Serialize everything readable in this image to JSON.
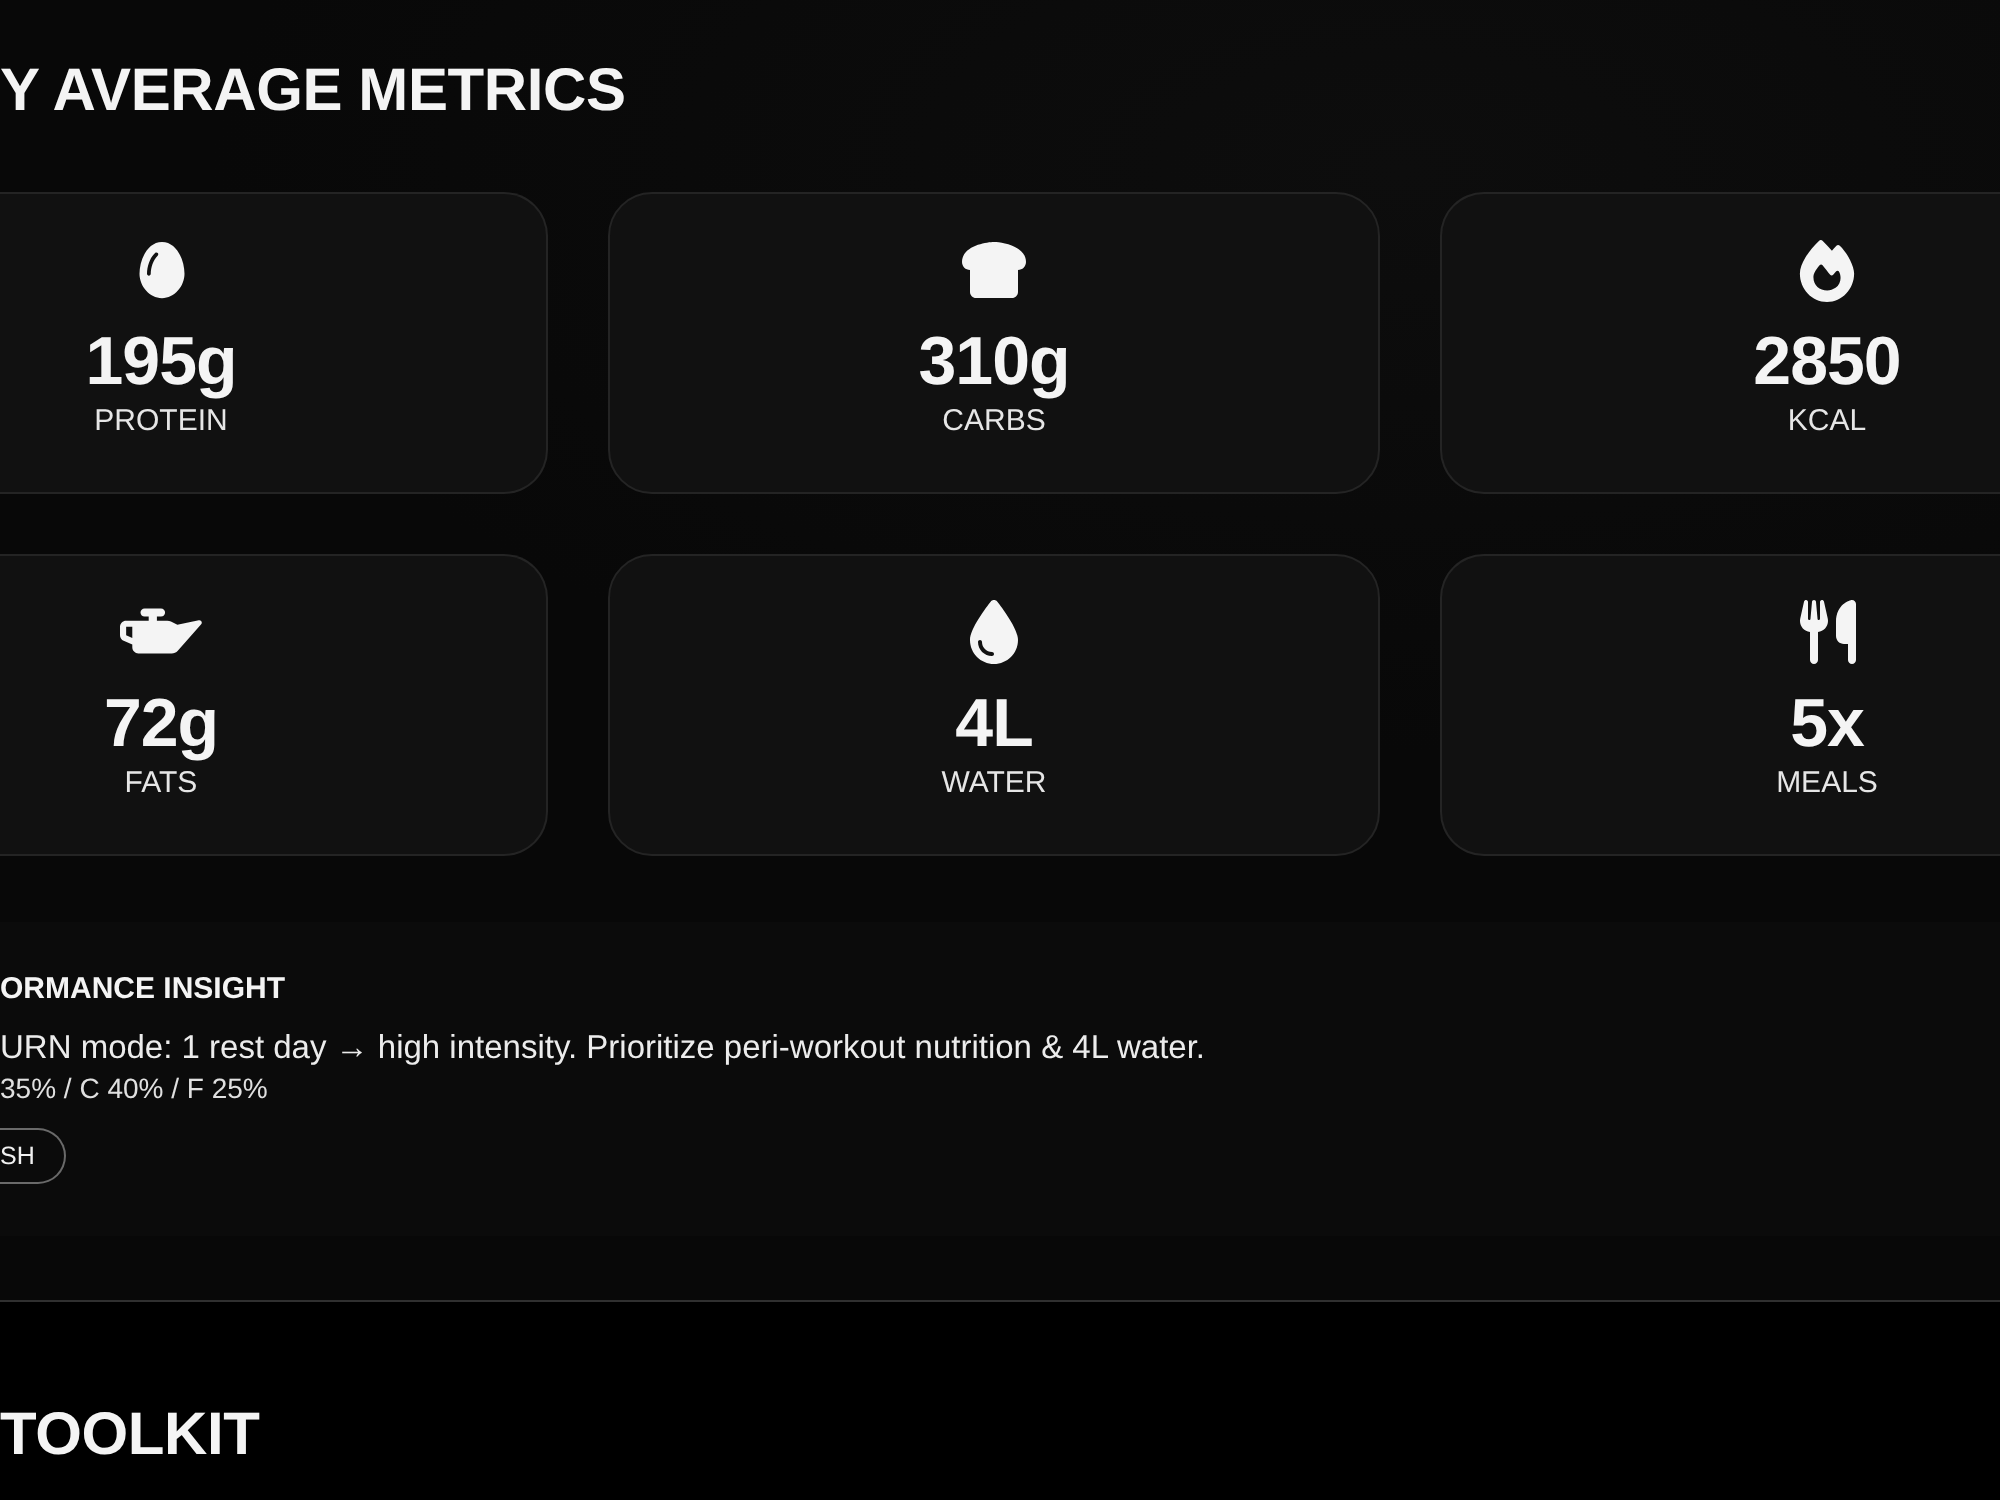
{
  "section_title": "Y AVERAGE METRICS",
  "metrics": [
    {
      "value": "195g",
      "label": "PROTEIN"
    },
    {
      "value": "310g",
      "label": "CARBS"
    },
    {
      "value": "2850",
      "label": "KCAL"
    },
    {
      "value": "72g",
      "label": "FATS"
    },
    {
      "value": "4L",
      "label": "WATER"
    },
    {
      "value": "5x",
      "label": "MEALS"
    }
  ],
  "insight": {
    "title": "ORMANCE INSIGHT",
    "message": "URN mode: 1 rest day → high intensity. Prioritize peri-workout nutrition & 4L water.",
    "macros": "35% / C 40% / F 25%",
    "button": "SH"
  },
  "next_section_title": "TOOLKIT"
}
